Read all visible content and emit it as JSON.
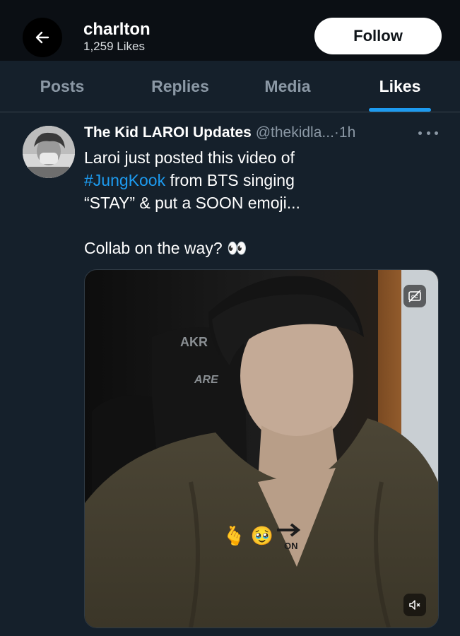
{
  "header": {
    "name": "charlton",
    "likes_count": "1,259 Likes",
    "follow_label": "Follow",
    "back_icon": "arrow-left-icon"
  },
  "tabs": [
    {
      "label": "Posts",
      "active": false
    },
    {
      "label": "Replies",
      "active": false
    },
    {
      "label": "Media",
      "active": false
    },
    {
      "label": "Likes",
      "active": true
    }
  ],
  "tweet": {
    "author": "The Kid LAROI Updates",
    "handle": "@thekidla...",
    "separator": "·",
    "time": "1h",
    "text_line1": "Laroi just posted this video of",
    "hashtag": "#JungKook",
    "text_line2_rest": " from BTS singing",
    "text_line3": "“STAY” & put a SOON emoji...",
    "text_line4": "Collab on the way? 👀",
    "media": {
      "type": "video",
      "chair_text_1": "AKR",
      "chair_text_2": "ARE",
      "overlay_emojis": "🫰 🥹",
      "overlay_sticker": "ON",
      "captions_icon": "captions-icon",
      "mute_icon": "speaker-muted-icon"
    }
  },
  "colors": {
    "background": "#15202b",
    "header_bg": "#0b0f14",
    "accent": "#1d9bf0",
    "muted_text": "#8b98a5"
  }
}
